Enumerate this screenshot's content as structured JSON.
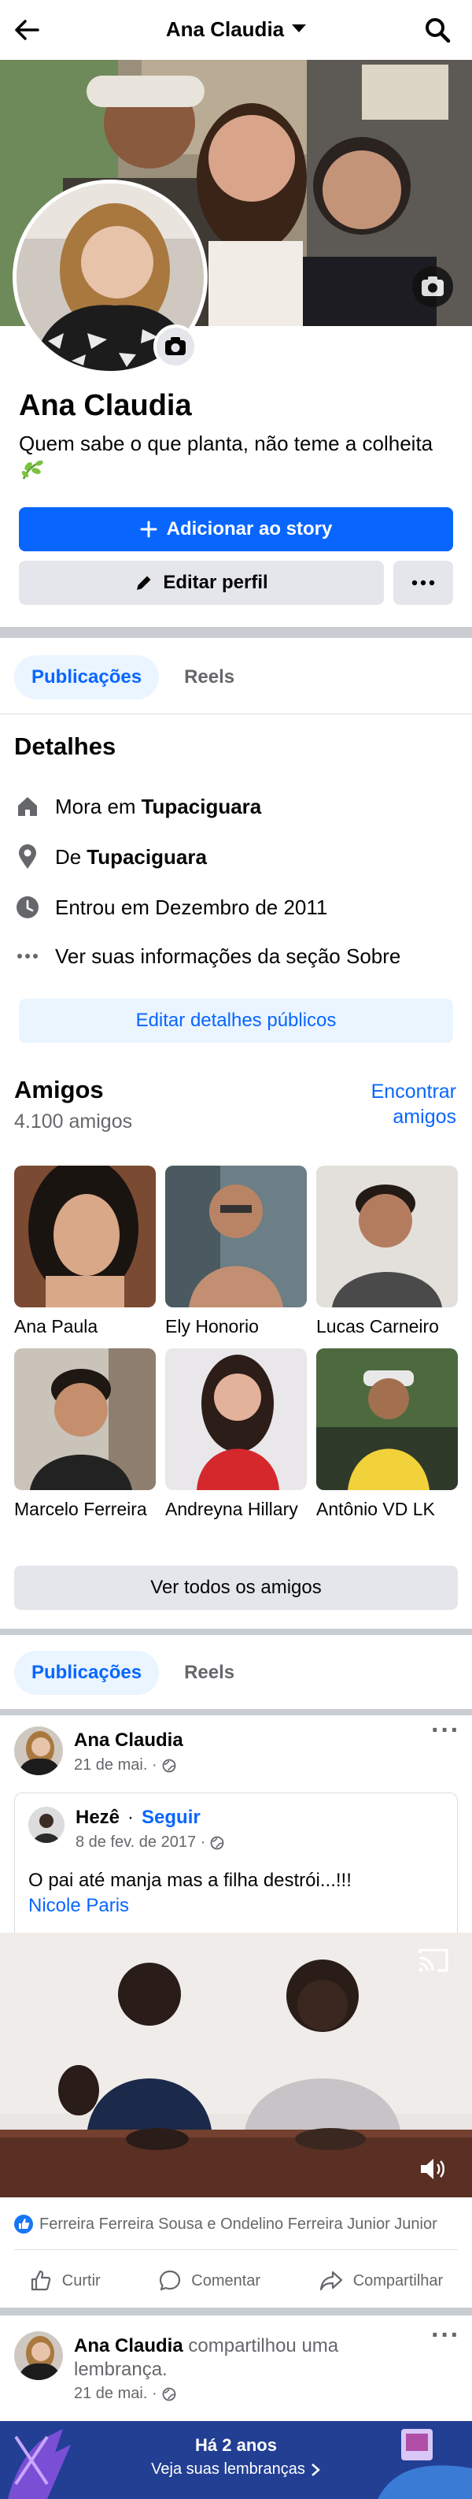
{
  "topbar": {
    "title": "Ana Claudia"
  },
  "profile": {
    "name": "Ana Claudia",
    "bio": "Quem sabe o que planta, não teme a colheita"
  },
  "buttons": {
    "add_story": "Adicionar ao story",
    "edit_profile": "Editar perfil"
  },
  "tabs": [
    {
      "label": "Publicações"
    },
    {
      "label": "Reels"
    }
  ],
  "details": {
    "title": "Detalhes",
    "lives_prefix": "Mora em",
    "lives_city": "Tupaciguara",
    "from_prefix": "De",
    "from_city": "Tupaciguara",
    "joined": "Entrou em Dezembro de 2011",
    "about": "Ver suas informações da seção Sobre",
    "edit_button": "Editar detalhes públicos"
  },
  "friends": {
    "title": "Amigos",
    "count": "4.100 amigos",
    "find_line1": "Encontrar",
    "find_line2": "amigos",
    "list": [
      {
        "name": "Ana Paula"
      },
      {
        "name": "Ely Honorio"
      },
      {
        "name": "Lucas Carneiro"
      },
      {
        "name": "Marcelo Ferreira"
      },
      {
        "name": "Andreyna Hillary"
      },
      {
        "name": "Antônio VD LK"
      }
    ],
    "see_all": "Ver todos os amigos"
  },
  "post1": {
    "author": "Ana Claudia",
    "date": "21 de mai. ·",
    "shared": {
      "author": "Hezê",
      "dot": "·",
      "follow": "Seguir",
      "date": "8 de fev. de 2017 ·",
      "text": "O pai até manja mas a filha destrói...!!!",
      "tag": "Nicole Paris"
    },
    "reactions": "Ferreira Ferreira Sousa e Ondelino Ferreira Junior Junior",
    "actions": {
      "like": "Curtir",
      "comment": "Comentar",
      "share": "Compartilhar"
    }
  },
  "post2": {
    "author": "Ana Claudia",
    "action_text": "compartilhou uma",
    "action_text2": "lembrança.",
    "date": "21 de mai. ·",
    "memory_title": "Há 2 anos",
    "memory_link": "Veja suas lembranças"
  },
  "colors": {
    "accent": "#0866ff",
    "accent_light": "#ebf5ff",
    "secondary_bg": "#e4e6eb",
    "muted_text": "#65676b"
  },
  "icons": [
    "back-arrow-icon",
    "caret-down-icon",
    "search-icon",
    "camera-icon",
    "leaf-icon",
    "plus-icon",
    "pencil-icon",
    "more-icon",
    "home-icon",
    "location-icon",
    "clock-icon",
    "globe-icon",
    "like-reaction-icon",
    "like-icon",
    "comment-icon",
    "share-icon",
    "cast-icon",
    "volume-icon",
    "chevron-right-icon"
  ]
}
